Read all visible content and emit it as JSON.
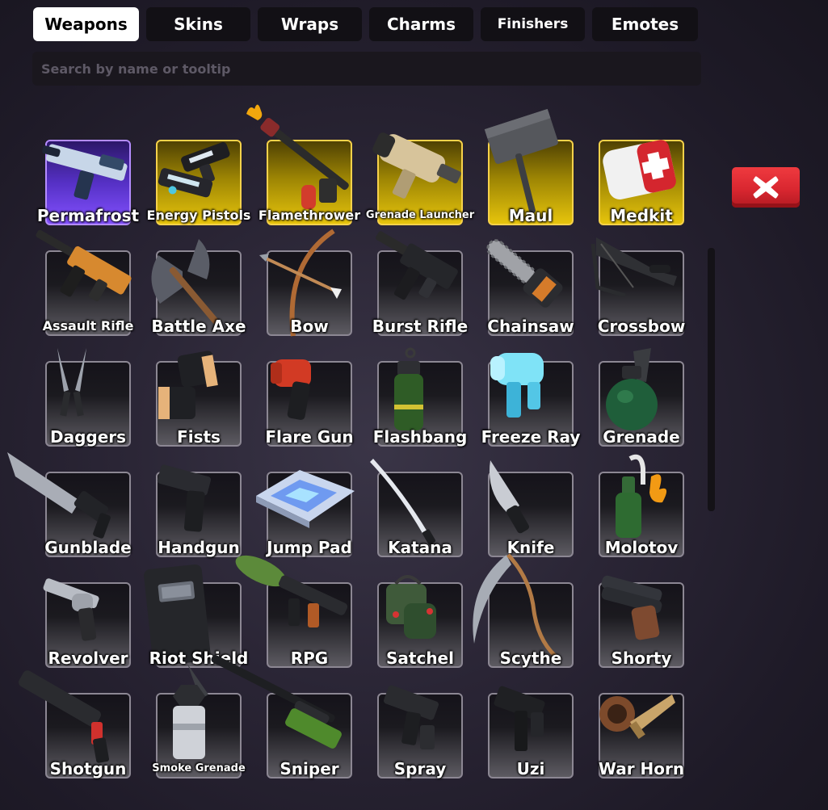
{
  "tabs": [
    {
      "label": "Weapons",
      "active": true
    },
    {
      "label": "Skins",
      "active": false
    },
    {
      "label": "Wraps",
      "active": false
    },
    {
      "label": "Charms",
      "active": false
    },
    {
      "label": "Finishers",
      "active": false
    },
    {
      "label": "Emotes",
      "active": false
    }
  ],
  "search": {
    "placeholder": "Search by name or tooltip",
    "value": ""
  },
  "close_icon": "close-x-icon",
  "colors": {
    "gold_rarity": "#f7d24a",
    "purple_rarity": "#b48cff",
    "close_red": "#e02b33"
  },
  "items": [
    {
      "label": "Permafrost",
      "rarity": "purple",
      "icon": "permafrost-rifle-icon"
    },
    {
      "label": "Energy Pistols",
      "rarity": "gold",
      "icon": "energy-pistols-icon"
    },
    {
      "label": "Flamethrower",
      "rarity": "gold",
      "icon": "flamethrower-icon"
    },
    {
      "label": "Grenade Launcher",
      "rarity": "gold",
      "icon": "grenade-launcher-icon"
    },
    {
      "label": "Maul",
      "rarity": "gold",
      "icon": "maul-icon"
    },
    {
      "label": "Medkit",
      "rarity": "gold",
      "icon": "medkit-icon"
    },
    {
      "label": "Assault Rifle",
      "rarity": "common",
      "icon": "assault-rifle-icon"
    },
    {
      "label": "Battle Axe",
      "rarity": "common",
      "icon": "battle-axe-icon"
    },
    {
      "label": "Bow",
      "rarity": "common",
      "icon": "bow-icon"
    },
    {
      "label": "Burst Rifle",
      "rarity": "common",
      "icon": "burst-rifle-icon"
    },
    {
      "label": "Chainsaw",
      "rarity": "common",
      "icon": "chainsaw-icon"
    },
    {
      "label": "Crossbow",
      "rarity": "common",
      "icon": "crossbow-icon"
    },
    {
      "label": "Daggers",
      "rarity": "common",
      "icon": "daggers-icon"
    },
    {
      "label": "Fists",
      "rarity": "common",
      "icon": "fists-icon"
    },
    {
      "label": "Flare Gun",
      "rarity": "common",
      "icon": "flare-gun-icon"
    },
    {
      "label": "Flashbang",
      "rarity": "common",
      "icon": "flashbang-icon"
    },
    {
      "label": "Freeze Ray",
      "rarity": "common",
      "icon": "freeze-ray-icon"
    },
    {
      "label": "Grenade",
      "rarity": "common",
      "icon": "grenade-icon"
    },
    {
      "label": "Gunblade",
      "rarity": "common",
      "icon": "gunblade-icon"
    },
    {
      "label": "Handgun",
      "rarity": "common",
      "icon": "handgun-icon"
    },
    {
      "label": "Jump Pad",
      "rarity": "common",
      "icon": "jump-pad-icon"
    },
    {
      "label": "Katana",
      "rarity": "common",
      "icon": "katana-icon"
    },
    {
      "label": "Knife",
      "rarity": "common",
      "icon": "knife-icon"
    },
    {
      "label": "Molotov",
      "rarity": "common",
      "icon": "molotov-icon"
    },
    {
      "label": "Revolver",
      "rarity": "common",
      "icon": "revolver-icon"
    },
    {
      "label": "Riot Shield",
      "rarity": "common",
      "icon": "riot-shield-icon"
    },
    {
      "label": "RPG",
      "rarity": "common",
      "icon": "rpg-icon"
    },
    {
      "label": "Satchel",
      "rarity": "common",
      "icon": "satchel-icon"
    },
    {
      "label": "Scythe",
      "rarity": "common",
      "icon": "scythe-icon"
    },
    {
      "label": "Shorty",
      "rarity": "common",
      "icon": "shorty-icon"
    },
    {
      "label": "Shotgun",
      "rarity": "common",
      "icon": "shotgun-icon"
    },
    {
      "label": "Smoke Grenade",
      "rarity": "common",
      "icon": "smoke-grenade-icon"
    },
    {
      "label": "Sniper",
      "rarity": "common",
      "icon": "sniper-icon"
    },
    {
      "label": "Spray",
      "rarity": "common",
      "icon": "spray-icon"
    },
    {
      "label": "Uzi",
      "rarity": "common",
      "icon": "uzi-icon"
    },
    {
      "label": "War Horn",
      "rarity": "common",
      "icon": "war-horn-icon"
    }
  ]
}
